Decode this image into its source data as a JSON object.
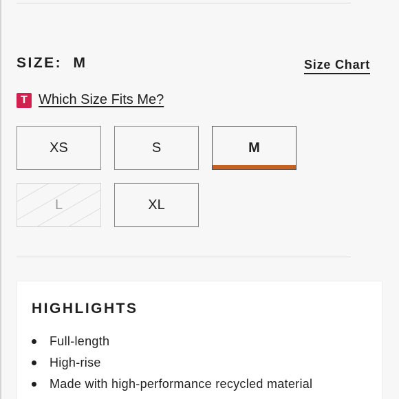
{
  "size_selector": {
    "label": "SIZE:",
    "selected_value": "M",
    "size_chart_link": "Size Chart",
    "fit_badge": "T",
    "fit_link": "Which Size Fits Me?",
    "options": [
      {
        "label": "XS",
        "state": "available"
      },
      {
        "label": "S",
        "state": "available"
      },
      {
        "label": "M",
        "state": "selected"
      },
      {
        "label": "L",
        "state": "unavailable"
      },
      {
        "label": "XL",
        "state": "available"
      }
    ],
    "accent_color": "#c8611e",
    "badge_color": "#d1214f"
  },
  "highlights": {
    "title": "HIGHLIGHTS",
    "items": [
      "Full-length",
      "High-rise",
      "Made with high-performance recycled material"
    ]
  }
}
